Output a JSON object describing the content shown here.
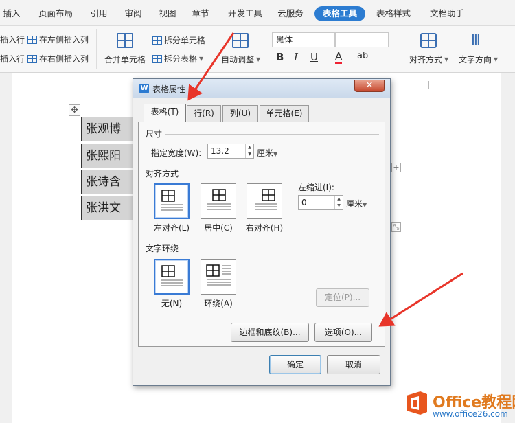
{
  "ribbon": {
    "tabs": [
      "插入",
      "页面布局",
      "引用",
      "审阅",
      "视图",
      "章节",
      "开发工具",
      "云服务",
      "表格工具",
      "表格样式",
      "文档助手"
    ],
    "active_tab": "表格工具",
    "insert_row_above": "插入行",
    "insert_row_below": "插入行",
    "insert_col_left": "在左侧插入列",
    "insert_col_right": "在右侧插入列",
    "merge_cells": "合并单元格",
    "split_cells": "拆分单元格",
    "split_table": "拆分表格",
    "auto_fit": "自动调整",
    "font_name": "黑体",
    "font_size": "",
    "bold": "B",
    "italic": "I",
    "underline": "U",
    "font_color": "A",
    "clear_format": "ab",
    "alignment": "对齐方式",
    "text_direction": "文字方向"
  },
  "document": {
    "table_cells": [
      "张观博",
      "张熙阳",
      "张诗含",
      "张洪文"
    ]
  },
  "dialog": {
    "title": "表格属性",
    "close": "✕",
    "tabs": [
      "表格(T)",
      "行(R)",
      "列(U)",
      "单元格(E)"
    ],
    "active_tab": "表格(T)",
    "size_group": "尺寸",
    "width_label": "指定宽度(W):",
    "width_value": "13.2",
    "width_unit": "厘米",
    "align_group": "对齐方式",
    "align_left": "左对齐(L)",
    "align_center": "居中(C)",
    "align_right": "右对齐(H)",
    "indent_label": "左缩进(I):",
    "indent_value": "0",
    "indent_unit": "厘米",
    "wrap_group": "文字环绕",
    "wrap_none": "无(N)",
    "wrap_around": "环绕(A)",
    "position_button": "定位(P)...",
    "borders_button": "边框和底纹(B)...",
    "options_button": "选项(O)...",
    "ok_button": "确定",
    "cancel_button": "取消"
  },
  "watermark": {
    "title": "Office教程网",
    "url": "www.office26.com"
  },
  "colors": {
    "accent": "#2c7cd1",
    "arrow": "#e8352a",
    "watermark_orange": "#e07a1f"
  }
}
